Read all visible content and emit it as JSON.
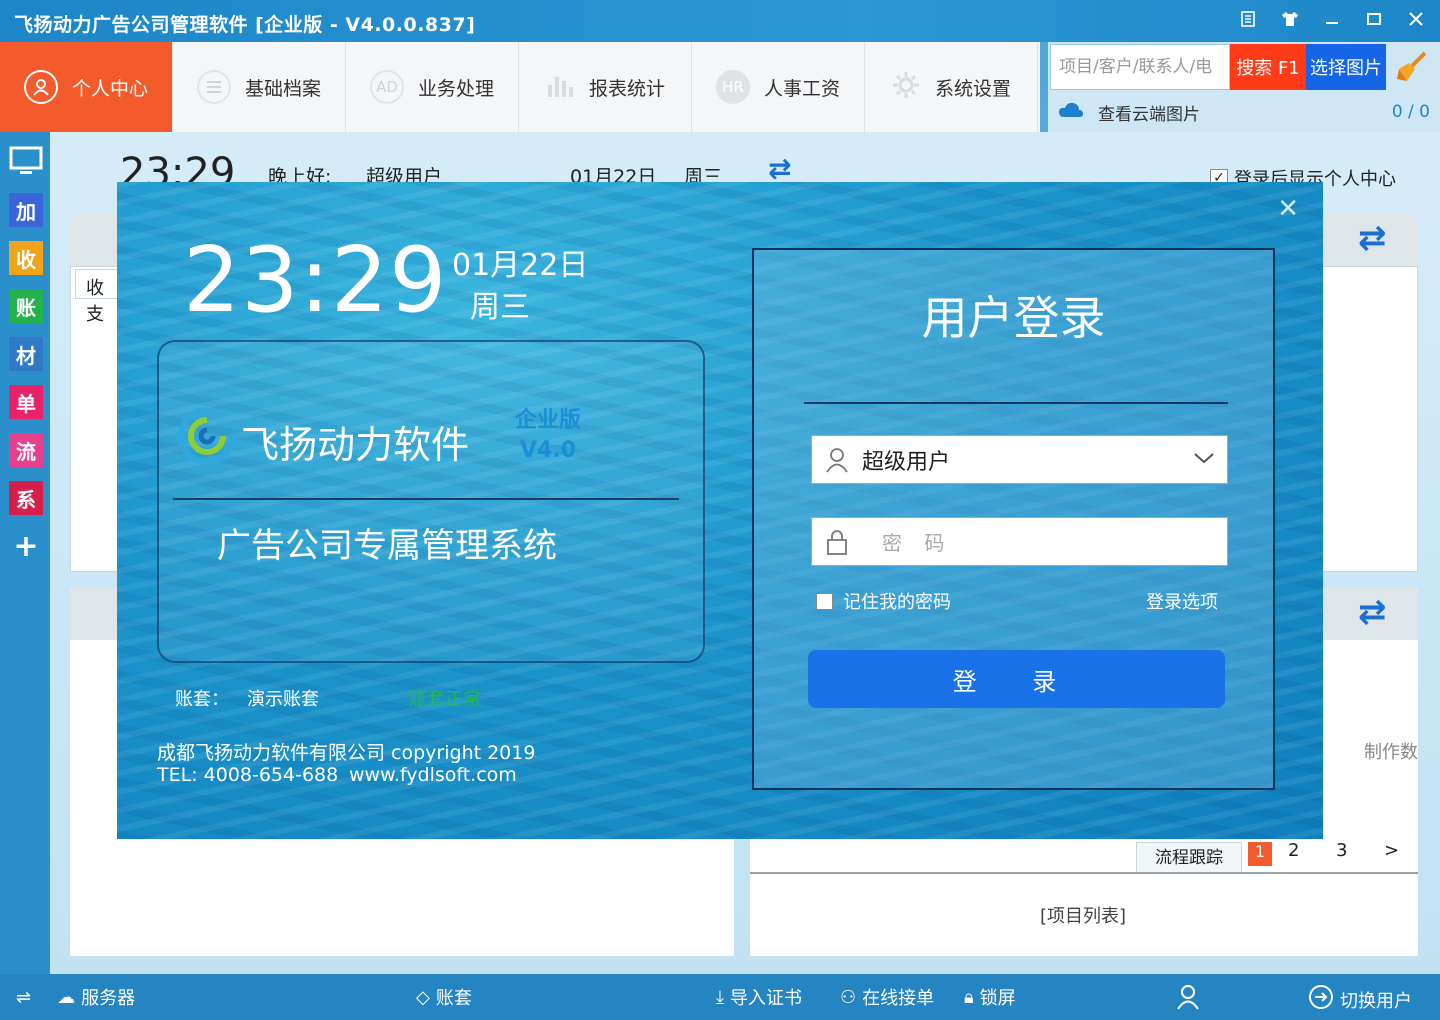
{
  "window": {
    "title": "飞扬动力广告公司管理软件 [企业版 - V4.0.0.837]",
    "buttons": [
      "menu-icon",
      "shirt-icon",
      "minimize-icon",
      "maximize-icon",
      "close-icon"
    ]
  },
  "nav": {
    "items": [
      {
        "label": "个人中心",
        "icon": "user-icon",
        "active": true
      },
      {
        "label": "基础档案",
        "icon": "list-icon"
      },
      {
        "label": "业务处理",
        "icon": "ad-icon",
        "icon_text": "AD"
      },
      {
        "label": "报表统计",
        "icon": "bar-chart-icon"
      },
      {
        "label": "人事工资",
        "icon": "hr-icon",
        "icon_text": "HR"
      },
      {
        "label": "系统设置",
        "icon": "gear-icon"
      }
    ]
  },
  "search": {
    "placeholder": "项目/客户/联系人/电",
    "search_label": "搜索 F1",
    "pick_label": "选择图片",
    "cloud_label": "查看云端图片",
    "cloud_count": "0 / 0"
  },
  "sidebar": {
    "items": [
      {
        "label": "",
        "icon": "monitor-icon",
        "color": "#2b8fcb"
      },
      {
        "label": "加",
        "color": "#3a66d8"
      },
      {
        "label": "收",
        "color": "#f0a419"
      },
      {
        "label": "账",
        "color": "#23b24b"
      },
      {
        "label": "材",
        "color": "#2f79c6"
      },
      {
        "label": "单",
        "color": "#e8216b"
      },
      {
        "label": "流",
        "color": "#e63f8e"
      },
      {
        "label": "系",
        "color": "#d6204b"
      },
      {
        "label": "+",
        "color": "#2b8fcb"
      }
    ]
  },
  "background": {
    "time": "23:29",
    "greeting": "晚上好:",
    "user": "超级用户",
    "date": "01月22日",
    "weekday": "周三",
    "show_center_label": "登录后显示个人中心",
    "tab_label": "收支",
    "pager": [
      "1",
      "2",
      "3",
      ">"
    ],
    "flow_tab": "流程跟踪",
    "list_label": "[项目列表]",
    "cut_label": "制作数"
  },
  "status": {
    "server": "服务器",
    "account_set": "账套",
    "import_cert": "导入证书",
    "online_order": "在线接单",
    "lock": "锁屏",
    "switch_user": "切换用户"
  },
  "login": {
    "time": "23:29",
    "date": "01月22日",
    "weekday": "周三",
    "brand_name": "飞扬动力软件",
    "edition": "企业版",
    "version": "V4.0",
    "slogan": "广告公司专属管理系统",
    "acct_label": "账套：",
    "acct_value": "演示账套",
    "acct_status": "账套正常",
    "company": "成都飞扬动力软件有限公司 copyright 2019",
    "tel": "TEL: 4008-654-688",
    "website": "www.fydlsoft.com",
    "title": "用户登录",
    "username": "超级用户",
    "password_placeholder": "密 码",
    "remember_label": "记住我的密码",
    "options_label": "登录选项",
    "login_button": "登 录"
  },
  "colors": {
    "accent": "#1a72e8",
    "active_nav": "#f35a2c",
    "search_button": "#ff3b1a",
    "status_ok": "#26b84c"
  }
}
